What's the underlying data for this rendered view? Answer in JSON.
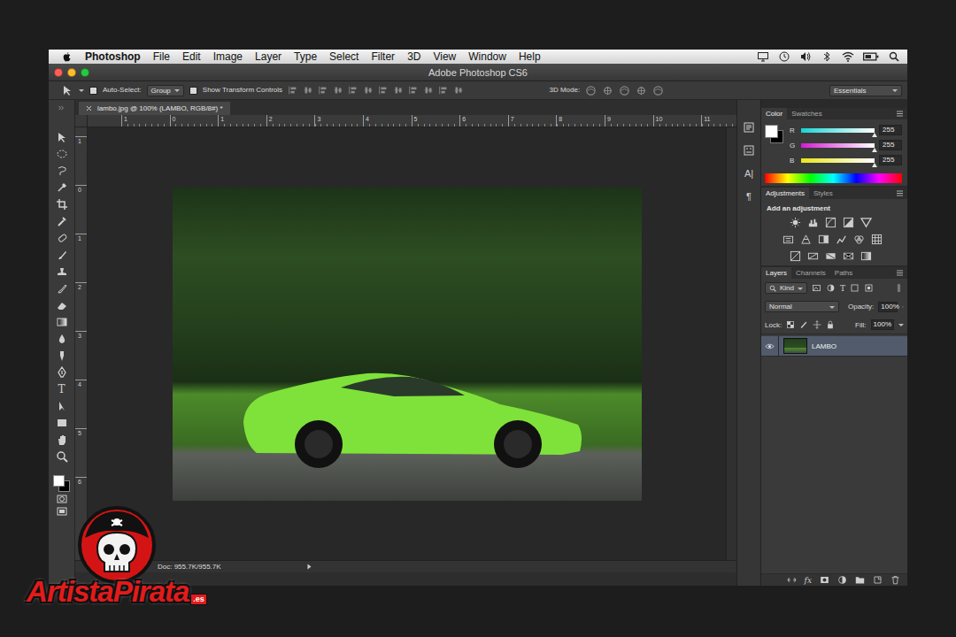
{
  "menu_bar": {
    "app": "Photoshop",
    "items": [
      "File",
      "Edit",
      "Image",
      "Layer",
      "Type",
      "Select",
      "Filter",
      "3D",
      "View",
      "Window",
      "Help"
    ]
  },
  "window": {
    "title": "Adobe Photoshop CS6"
  },
  "options_bar": {
    "auto_select": {
      "label": "Auto-Select:",
      "checked": false
    },
    "auto_select_target": "Group",
    "transform_controls": {
      "label": "Show Transform Controls",
      "checked": false
    },
    "mode_label": "3D Mode:",
    "workspace": "Essentials"
  },
  "tools": {
    "type_glyph": "T",
    "foreground": "#ffffff",
    "background": "#000000"
  },
  "document": {
    "tab": "lambo.jpg @ 100% (LAMBO, RGB/8#) *",
    "ruler_top": [
      "1",
      "0",
      "1",
      "2",
      "3",
      "4",
      "5",
      "6",
      "7",
      "8",
      "9",
      "10",
      "11"
    ],
    "ruler_left": [
      "1",
      "0",
      "1",
      "2",
      "3",
      "4",
      "5",
      "6"
    ],
    "status": "Doc: 955.7K/955.7K"
  },
  "dock": {
    "glyphs": [
      "A|",
      "¶"
    ]
  },
  "color_panel": {
    "tabs": [
      {
        "label": "Color",
        "selected": true
      },
      {
        "label": "Swatches",
        "selected": false
      }
    ],
    "foreground": "#ffffff",
    "background": "#000000",
    "channels": [
      {
        "name": "R",
        "value": "255",
        "level": 1,
        "color": "#19d3d3"
      },
      {
        "name": "G",
        "value": "255",
        "level": 1,
        "color": "#d21cd2"
      },
      {
        "name": "B",
        "value": "255",
        "level": 1,
        "color": "#e6e619"
      }
    ]
  },
  "adjustments_panel": {
    "tabs": [
      {
        "label": "Adjustments",
        "selected": true
      },
      {
        "label": "Styles",
        "selected": false
      }
    ],
    "heading": "Add an adjustment"
  },
  "layers_panel": {
    "tabs": [
      {
        "label": "Layers",
        "selected": true
      },
      {
        "label": "Channels",
        "selected": false
      },
      {
        "label": "Paths",
        "selected": false
      }
    ],
    "filter": "Kind",
    "filter_type_glyph": "T",
    "blend_mode": "Normal",
    "opacity_label": "Opacity:",
    "opacity": "100%",
    "lock_label": "Lock:",
    "fill_label": "Fill:",
    "fill": "100%",
    "layers": [
      {
        "name": "LAMBO",
        "visible": true,
        "selected": true
      }
    ],
    "fx_label": "fx"
  },
  "watermark": {
    "brand": "ArtistaPirata",
    "suffix": ".es"
  }
}
